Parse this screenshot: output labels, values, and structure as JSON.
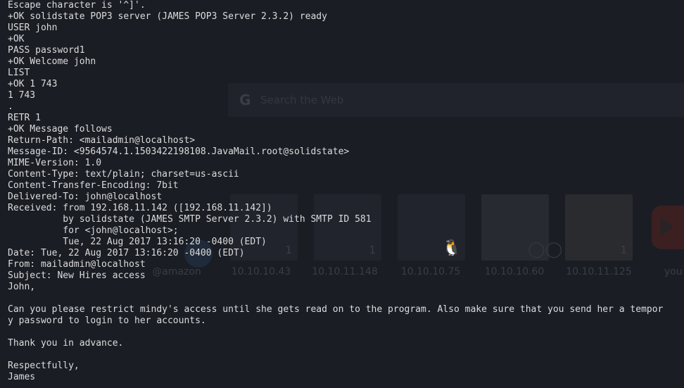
{
  "terminal": {
    "lines": [
      "Escape character is '^]'.",
      "+OK solidstate POP3 server (JAMES POP3 Server 2.3.2) ready",
      "USER john",
      "+OK",
      "PASS password1",
      "+OK Welcome john",
      "LIST",
      "+OK 1 743",
      "1 743",
      ".",
      "RETR 1",
      "+OK Message follows",
      "Return-Path: <mailadmin@localhost>",
      "Message-ID: <9564574.1.1503422198108.JavaMail.root@solidstate>",
      "MIME-Version: 1.0",
      "Content-Type: text/plain; charset=us-ascii",
      "Content-Transfer-Encoding: 7bit",
      "Delivered-To: john@localhost",
      "Received: from 192.168.11.142 ([192.168.11.142])",
      "          by solidstate (JAMES SMTP Server 2.3.2) with SMTP ID 581",
      "          for <john@localhost>;",
      "          Tue, 22 Aug 2017 13:16:20 -0400 (EDT)",
      "Date: Tue, 22 Aug 2017 13:16:20 -0400 (EDT)",
      "From: mailadmin@localhost",
      "Subject: New Hires access",
      "John,",
      "",
      "Can you please restrict mindy's access until she gets read on to the program. Also make sure that you send her a tempor",
      "y password to login to her accounts.",
      "",
      "Thank you in advance.",
      "",
      "Respectfully,",
      "James"
    ]
  },
  "background_page": {
    "search_placeholder": "Search the Web",
    "search_logo": "G",
    "tiles": [
      {
        "label": "@amazon",
        "badge": ""
      },
      {
        "label": "10.10.10.43",
        "badge": "1"
      },
      {
        "label": "10.10.11.148",
        "badge": "1"
      },
      {
        "label": "10.10.10.75",
        "badge": ""
      },
      {
        "label": "10.10.10.60",
        "badge": ""
      },
      {
        "label": "10.10.11.125",
        "badge": "1"
      },
      {
        "label": "you",
        "badge": ""
      }
    ]
  },
  "colors": {
    "terminal_bg": "#1b1d24",
    "terminal_fg": "#dcdcdc"
  }
}
